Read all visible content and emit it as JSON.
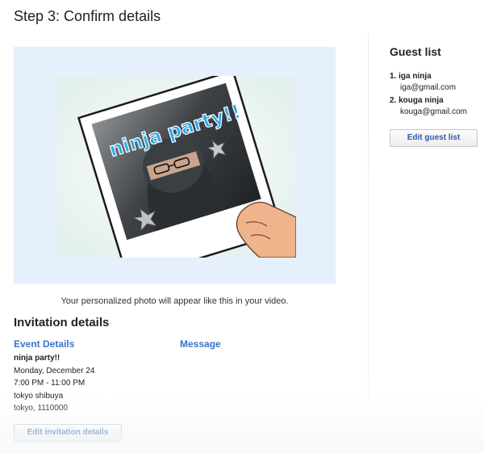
{
  "page": {
    "title": "Step 3: Confirm details"
  },
  "preview": {
    "photo_text": "ninja party!!",
    "caption": "Your personalized photo will appear like this in your video."
  },
  "invitation": {
    "section_title": "Invitation details",
    "event_heading": "Event Details",
    "message_heading": "Message",
    "event_name": "ninja party!!",
    "date": "Monday, December 24",
    "time": "7:00 PM - 11:00 PM",
    "location": "tokyo shibuya",
    "city": "tokyo, 1110000",
    "edit_button": "Edit invitation details"
  },
  "guests": {
    "title": "Guest list",
    "items": [
      {
        "name": "1. iga ninja",
        "email": "iga@gmail.com"
      },
      {
        "name": "2. kouga ninja",
        "email": "kouga@gmail.com"
      }
    ],
    "edit_button": "Edit guest list"
  },
  "colors": {
    "link_blue": "#3a73c4",
    "panel_bg": "#e6effc",
    "button_text": "#2a5aa8"
  }
}
